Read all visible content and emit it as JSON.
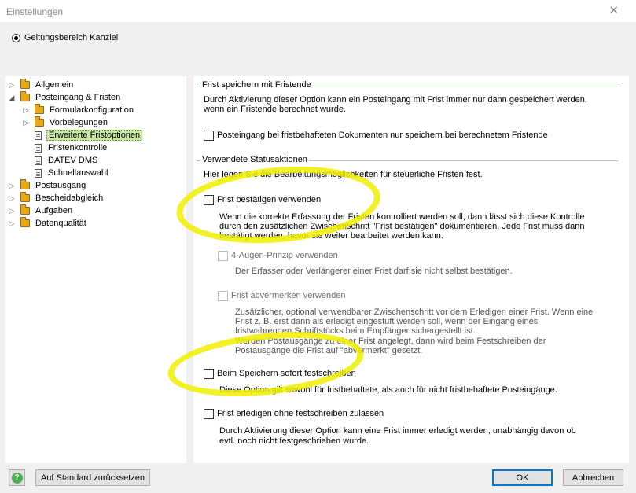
{
  "window": {
    "title": "Einstellungen",
    "close_glyph": "✕"
  },
  "scope": {
    "label": "Geltungsbereich Kanzlei",
    "selected": true
  },
  "tree": [
    {
      "label": "Allgemein",
      "type": "folder",
      "expander": "▷",
      "level": 0
    },
    {
      "label": "Posteingang & Fristen",
      "type": "folder",
      "expander": "◢",
      "level": 0
    },
    {
      "label": "Formularkonfiguration",
      "type": "folder",
      "expander": "▷",
      "level": 1
    },
    {
      "label": "Vorbelegungen",
      "type": "folder",
      "expander": "▷",
      "level": 1
    },
    {
      "label": "Erweiterte Fristoptionen",
      "type": "doc",
      "expander": "",
      "level": 1,
      "selected": true
    },
    {
      "label": "Fristenkontrolle",
      "type": "doc",
      "expander": "",
      "level": 1
    },
    {
      "label": "DATEV DMS",
      "type": "doc",
      "expander": "",
      "level": 1
    },
    {
      "label": "Schnellauswahl",
      "type": "doc",
      "expander": "",
      "level": 1
    },
    {
      "label": "Postausgang",
      "type": "folder",
      "expander": "▷",
      "level": 0
    },
    {
      "label": "Bescheidabgleich",
      "type": "folder",
      "expander": "▷",
      "level": 0
    },
    {
      "label": "Aufgaben",
      "type": "folder",
      "expander": "▷",
      "level": 0
    },
    {
      "label": "Datenqualität",
      "type": "folder",
      "expander": "▷",
      "level": 0
    }
  ],
  "section1": {
    "title": "Frist speichern mit Fristende",
    "description_1": "Durch Aktivierung dieser Option kann ein Posteingang mit Frist immer nur dann gespeichert werden,",
    "description_2": "wenn ein Fristende berechnet wurde.",
    "checkbox_label": "Posteingang bei fristbehafteten Dokumenten nur speichern bei berechnetem Fristende"
  },
  "section2": {
    "title": "Verwendete Statusaktionen",
    "intro": "Hier legen Sie die Bearbeitungsmöglichkeiten für steuerliche Fristen fest.",
    "confirm": {
      "label": "Frist bestätigen verwenden",
      "desc_1": "Wenn die korrekte Erfassung der Fristen kontrolliert werden soll, dann lässt sich diese Kontrolle",
      "desc_2": "durch den zusätzlichen Zwischenschritt \"Frist bestätigen\" dokumentieren. Jede Frist muss dann",
      "desc_3": "bestätigt werden, bevor sie weiter bearbeitet werden kann."
    },
    "four_eyes": {
      "label": "4-Augen-Prinzip verwenden",
      "desc": "Der Erfasser oder Verlängerer einer Frist darf sie nicht selbst bestätigen."
    },
    "mark": {
      "label": "Frist abvermerken verwenden",
      "desc_1": "Zusätzlicher, optional verwendbarer Zwischenschritt vor dem Erledigen einer Frist. Wenn eine",
      "desc_2": "Frist z. B. erst dann als erledigt eingestuft werden soll, wenn der Eingang eines",
      "desc_3": "fristwahrenden Schriftstücks beim Empfänger sichergestellt ist.",
      "desc_4": "Werden Postausgänge zu einer Frist angelegt, dann wird beim Festschreiben der",
      "desc_5": "Postausgänge die Frist auf \"abvermerkt\" gesetzt."
    },
    "lock": {
      "label": "Beim Speichern sofort festschreiben",
      "desc": "Diese Option gilt sowohl für fristbehaftete, als auch für nicht fristbehaftete Posteingänge."
    },
    "complete": {
      "label": "Frist erledigen ohne festschreiben zulassen",
      "desc_1": "Durch Aktivierung dieser Option kann eine Frist immer erledigt werden, unabhängig davon ob",
      "desc_2": "evtl. noch nicht festgeschrieben wurde."
    }
  },
  "footer": {
    "help_glyph": "?",
    "reset_label": "Auf Standard zurücksetzen",
    "ok_label": "OK",
    "cancel_label": "Abbrechen"
  },
  "colors": {
    "highlight": "#eeee00",
    "selection": "#cde9a6",
    "folder": "#e6a91d",
    "accent": "#0078d7"
  }
}
